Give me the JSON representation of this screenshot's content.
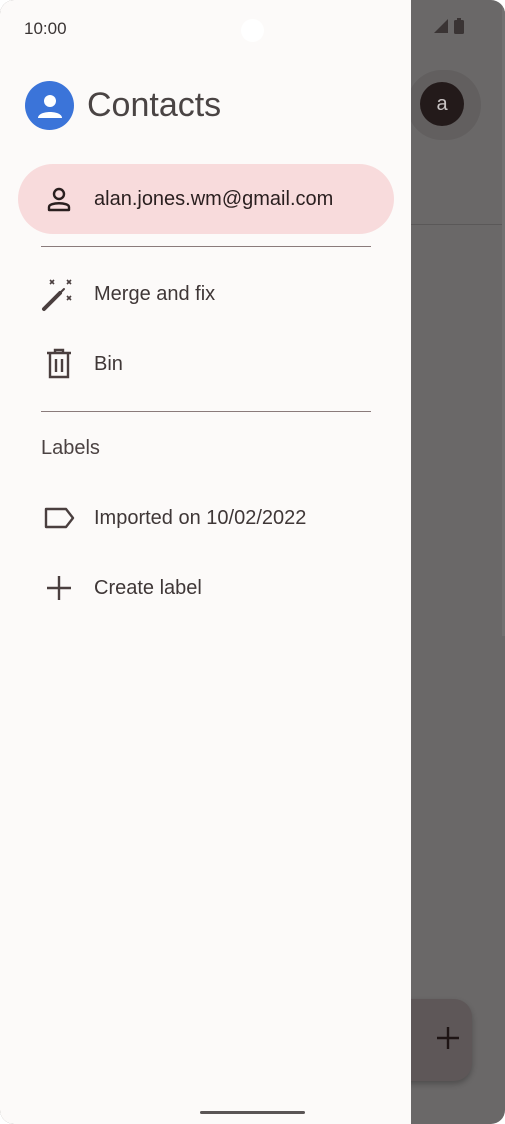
{
  "status_bar": {
    "time": "10:00",
    "icons": [
      "signal-icon",
      "battery-icon"
    ]
  },
  "drawer": {
    "app_title": "Contacts",
    "account": {
      "email": "alan.jones.wm@gmail.com",
      "icon": "person-outline-icon"
    },
    "items": [
      {
        "label": "Merge and fix",
        "icon": "magic-wand-icon"
      },
      {
        "label": "Bin",
        "icon": "trash-icon"
      }
    ],
    "labels_section": {
      "header": "Labels",
      "items": [
        {
          "label": "Imported on 10/02/2022",
          "icon": "label-outline-icon"
        },
        {
          "label": "Create label",
          "icon": "plus-icon"
        }
      ]
    }
  },
  "background": {
    "avatar_letter": "a"
  },
  "colors": {
    "drawer_bg": "#fcfaf9",
    "selected_pill": "#f8dbdc",
    "app_logo": "#3b74d9",
    "scrim": "#6a6868"
  }
}
